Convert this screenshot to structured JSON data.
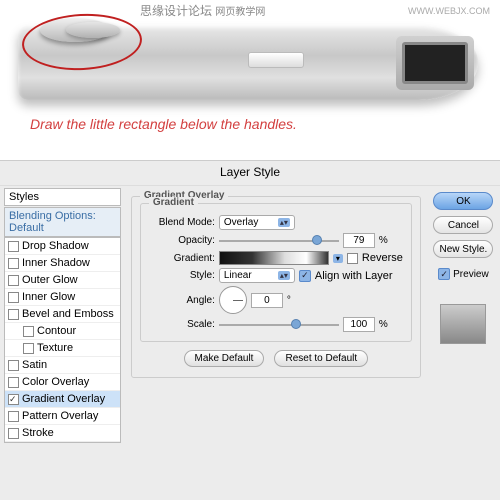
{
  "header": {
    "site_cn": "思缘设计论坛",
    "site_suffix": "网页教学网",
    "url": "WWW.WEBJX.COM"
  },
  "caption": "Draw the little rectangle below the handles.",
  "dialog": {
    "title": "Layer Style"
  },
  "styles": {
    "header": "Styles",
    "blending": "Blending Options: Default",
    "items": [
      {
        "label": "Drop Shadow",
        "checked": false
      },
      {
        "label": "Inner Shadow",
        "checked": false
      },
      {
        "label": "Outer Glow",
        "checked": false
      },
      {
        "label": "Inner Glow",
        "checked": false
      },
      {
        "label": "Bevel and Emboss",
        "checked": false
      },
      {
        "label": "Contour",
        "checked": false,
        "indent": true
      },
      {
        "label": "Texture",
        "checked": false,
        "indent": true
      },
      {
        "label": "Satin",
        "checked": false
      },
      {
        "label": "Color Overlay",
        "checked": false
      },
      {
        "label": "Gradient Overlay",
        "checked": true,
        "selected": true
      },
      {
        "label": "Pattern Overlay",
        "checked": false
      },
      {
        "label": "Stroke",
        "checked": false
      }
    ]
  },
  "gradient": {
    "group": "Gradient Overlay",
    "subgroup": "Gradient",
    "blend_label": "Blend Mode:",
    "blend_value": "Overlay",
    "opacity_label": "Opacity:",
    "opacity_value": "79",
    "pct": "%",
    "gradient_label": "Gradient:",
    "reverse_label": "Reverse",
    "style_label": "Style:",
    "style_value": "Linear",
    "align_label": "Align with Layer",
    "angle_label": "Angle:",
    "angle_value": "0",
    "deg": "°",
    "scale_label": "Scale:",
    "scale_value": "100",
    "make_default": "Make Default",
    "reset_default": "Reset to Default"
  },
  "buttons": {
    "ok": "OK",
    "cancel": "Cancel",
    "new_style": "New Style.",
    "preview": "Preview"
  }
}
